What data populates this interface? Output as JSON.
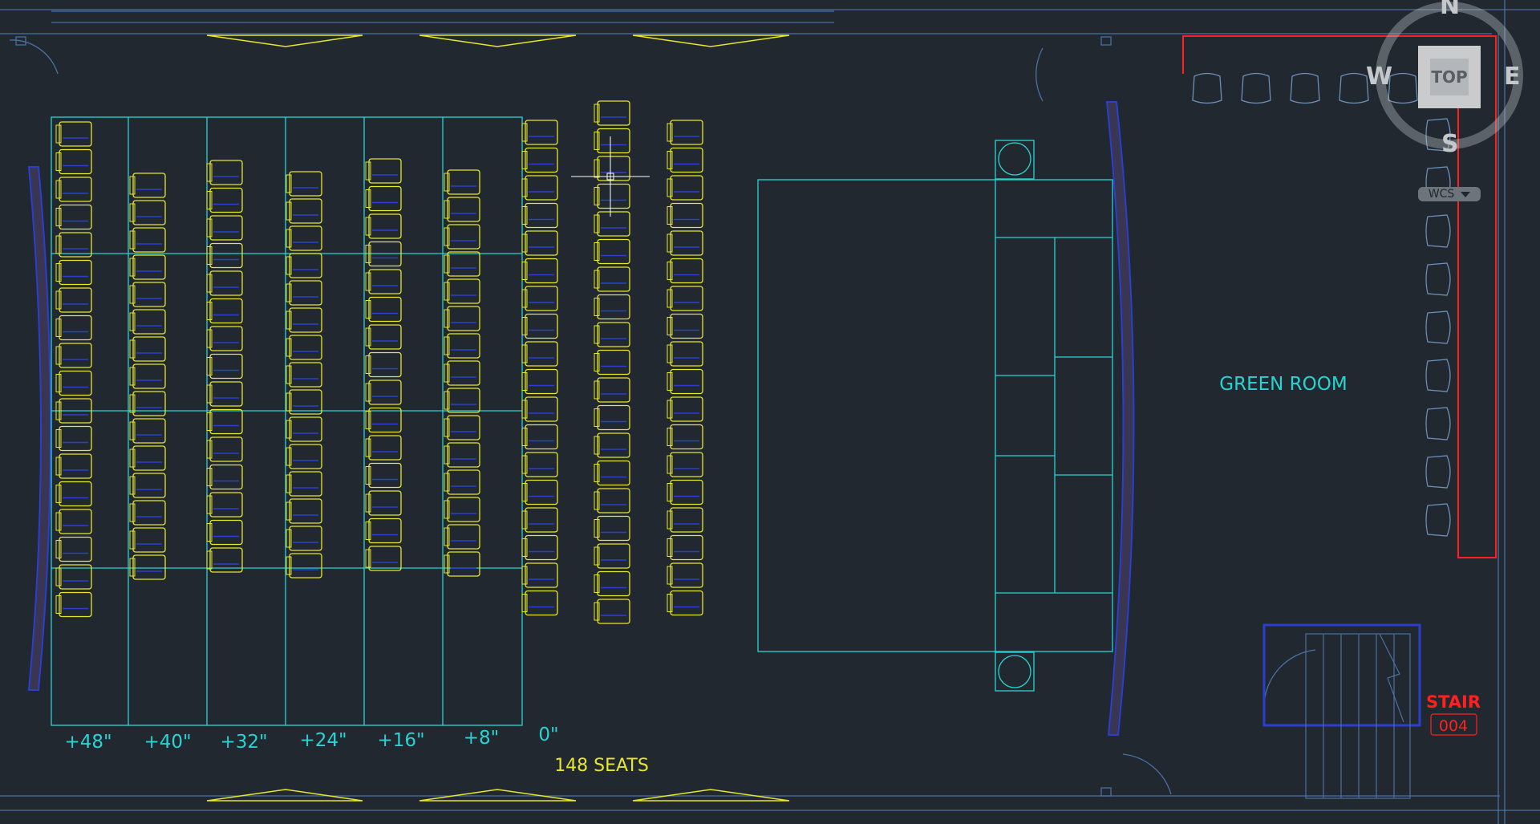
{
  "drawing": {
    "row_labels": [
      "+48\"",
      "+40\"",
      "+32\"",
      "+24\"",
      "+16\"",
      "+8\"",
      "0\""
    ],
    "seat_count_label": "148 SEATS",
    "room_label": "GREEN ROOM",
    "stair_label": "STAIR",
    "stair_number": "004"
  },
  "viewcube": {
    "top": "TOP",
    "north": "N",
    "south": "S",
    "east": "E",
    "west": "W"
  },
  "wcs": {
    "label": "WCS",
    "icon": "chevron-down-icon"
  },
  "colors": {
    "background": "#212830",
    "seats": "#e6e62a",
    "grid": "#29d3d3",
    "walls": "#4b70a0",
    "red": "#ff2020"
  }
}
